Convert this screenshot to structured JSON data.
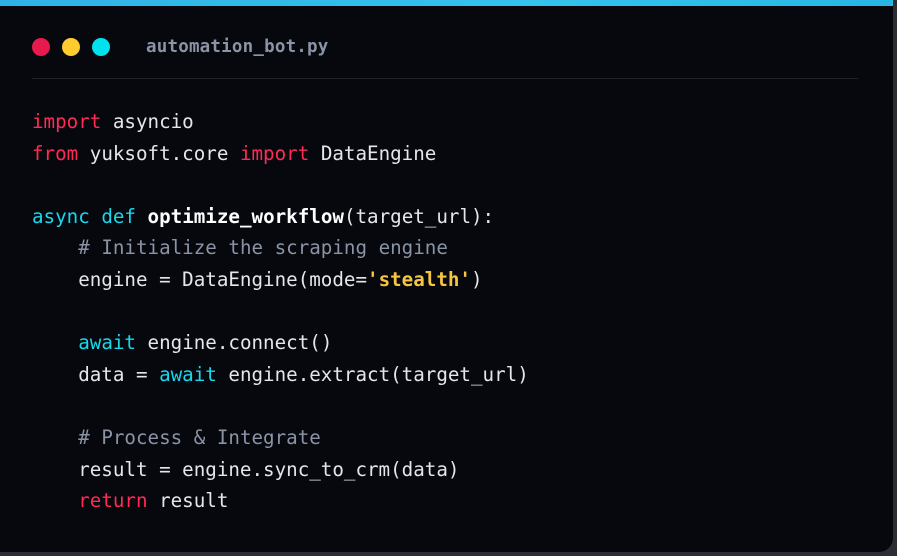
{
  "window": {
    "filename": "automation_bot.py",
    "dots": [
      {
        "name": "close",
        "color": "#e8194c"
      },
      {
        "name": "minimize",
        "color": "#ffcc2f"
      },
      {
        "name": "maximize",
        "color": "#00e1f0"
      }
    ]
  },
  "code": {
    "lines": [
      [
        {
          "t": "import",
          "k": "import"
        },
        {
          "t": " asyncio",
          "k": "plain"
        }
      ],
      [
        {
          "t": "from",
          "k": "import"
        },
        {
          "t": " yuksoft.core ",
          "k": "plain"
        },
        {
          "t": "import",
          "k": "import"
        },
        {
          "t": " DataEngine",
          "k": "plain"
        }
      ],
      [],
      [
        {
          "t": "async",
          "k": "async"
        },
        {
          "t": " ",
          "k": "plain"
        },
        {
          "t": "def",
          "k": "async"
        },
        {
          "t": " ",
          "k": "plain"
        },
        {
          "t": "optimize_workflow",
          "k": "fn"
        },
        {
          "t": "(target_url):",
          "k": "plain"
        }
      ],
      [
        {
          "t": "    ",
          "k": "plain"
        },
        {
          "t": "# Initialize the scraping engine",
          "k": "comment"
        }
      ],
      [
        {
          "t": "    engine = DataEngine(mode=",
          "k": "plain"
        },
        {
          "t": "'stealth'",
          "k": "string"
        },
        {
          "t": ")",
          "k": "plain"
        }
      ],
      [],
      [
        {
          "t": "    ",
          "k": "plain"
        },
        {
          "t": "await",
          "k": "async"
        },
        {
          "t": " engine.connect()",
          "k": "plain"
        }
      ],
      [
        {
          "t": "    data = ",
          "k": "plain"
        },
        {
          "t": "await",
          "k": "async"
        },
        {
          "t": " engine.extract(target_url)",
          "k": "plain"
        }
      ],
      [],
      [
        {
          "t": "    ",
          "k": "plain"
        },
        {
          "t": "# Process & Integrate",
          "k": "comment"
        }
      ],
      [
        {
          "t": "    result = engine.sync_to_crm(data)",
          "k": "plain"
        }
      ],
      [
        {
          "t": "    ",
          "k": "plain"
        },
        {
          "t": "return",
          "k": "import"
        },
        {
          "t": " result",
          "k": "plain"
        }
      ]
    ]
  }
}
